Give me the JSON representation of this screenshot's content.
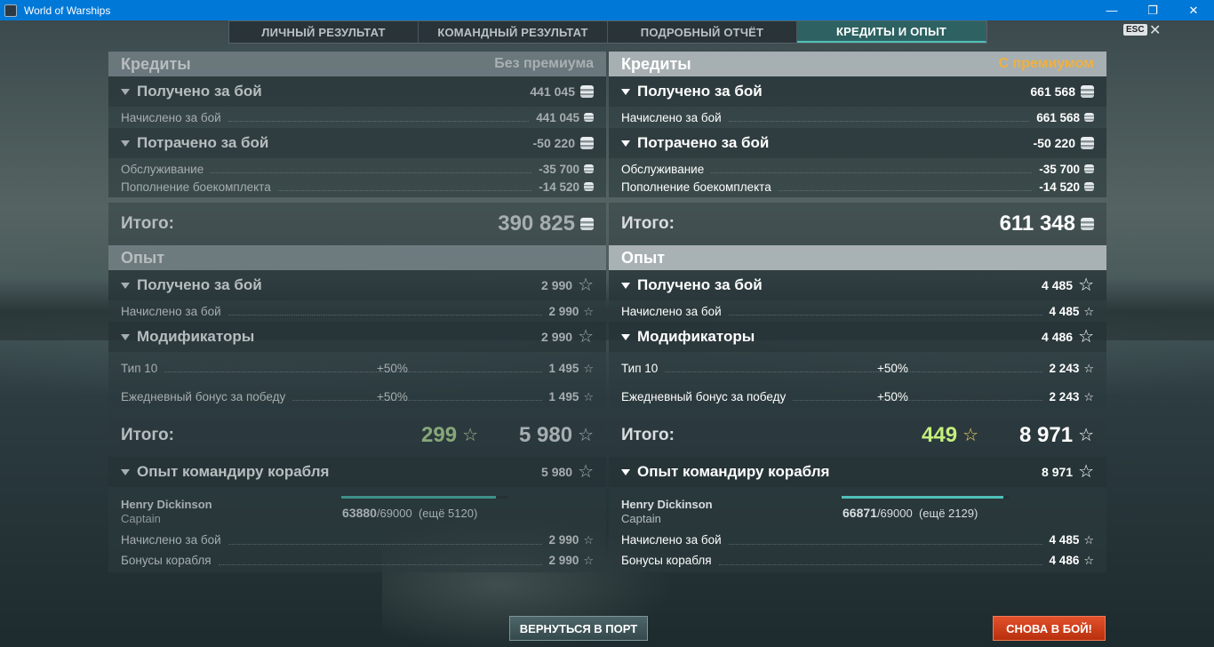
{
  "window": {
    "title": "World of Warships",
    "minimize": "—",
    "restore": "❐",
    "close": "✕"
  },
  "tabs": [
    {
      "label": "ЛИЧНЫЙ РЕЗУЛЬТАТ"
    },
    {
      "label": "КОМАНДНЫЙ РЕЗУЛЬТАТ"
    },
    {
      "label": "ПОДРОБНЫЙ ОТЧЁТ"
    },
    {
      "label": "КРЕДИТЫ И ОПЫТ"
    }
  ],
  "esc": {
    "key": "ESC",
    "close": "✕"
  },
  "left": {
    "credits": {
      "title": "Кредиты",
      "badge": "Без премиума",
      "earned": {
        "label": "Получено за бой",
        "value": "441 045"
      },
      "earned_rows": [
        {
          "label": "Начислено за бой",
          "value": "441 045"
        }
      ],
      "spent": {
        "label": "Потрачено за бой",
        "value": "-50 220"
      },
      "spent_rows": [
        {
          "label": "Обслуживание",
          "value": "-35 700"
        },
        {
          "label": "Пополнение боекомплекта",
          "value": "-14 520"
        }
      ],
      "total": {
        "label": "Итого:",
        "value": "390 825"
      }
    },
    "xp": {
      "title": "Опыт",
      "earned": {
        "label": "Получено за бой",
        "value": "2 990"
      },
      "earned_rows": [
        {
          "label": "Начислено за бой",
          "value": "2 990"
        }
      ],
      "mods": {
        "label": "Модификаторы",
        "value": "2 990"
      },
      "mod_rows": [
        {
          "label": "Тип 10",
          "pct": "+50%",
          "value": "1 495"
        },
        {
          "label": "Ежедневный бонус за победу",
          "pct": "+50%",
          "value": "1 495"
        }
      ],
      "total": {
        "label": "Итого:",
        "bonus": "299",
        "value": "5 980"
      },
      "commander": {
        "label": "Опыт командиру корабля",
        "value": "5 980"
      },
      "captain": {
        "name": "Henry Dickinson",
        "rank": "Captain",
        "current": "63880",
        "max": "/69000",
        "remaining": "(ещё 5120)",
        "progress": 0.926
      },
      "captain_rows": [
        {
          "label": "Начислено за бой",
          "value": "2 990"
        },
        {
          "label": "Бонусы корабля",
          "value": "2 990"
        }
      ]
    }
  },
  "right": {
    "credits": {
      "title": "Кредиты",
      "badge": "С премиумом",
      "earned": {
        "label": "Получено за бой",
        "value": "661 568"
      },
      "earned_rows": [
        {
          "label": "Начислено за бой",
          "value": "661 568"
        }
      ],
      "spent": {
        "label": "Потрачено за бой",
        "value": "-50 220"
      },
      "spent_rows": [
        {
          "label": "Обслуживание",
          "value": "-35 700"
        },
        {
          "label": "Пополнение боекомплекта",
          "value": "-14 520"
        }
      ],
      "total": {
        "label": "Итого:",
        "value": "611 348"
      }
    },
    "xp": {
      "title": "Опыт",
      "earned": {
        "label": "Получено за бой",
        "value": "4 485"
      },
      "earned_rows": [
        {
          "label": "Начислено за бой",
          "value": "4 485"
        }
      ],
      "mods": {
        "label": "Модификаторы",
        "value": "4 486"
      },
      "mod_rows": [
        {
          "label": "Тип 10",
          "pct": "+50%",
          "value": "2 243"
        },
        {
          "label": "Ежедневный бонус за победу",
          "pct": "+50%",
          "value": "2 243"
        }
      ],
      "total": {
        "label": "Итого:",
        "bonus": "449",
        "value": "8 971"
      },
      "commander": {
        "label": "Опыт командиру корабля",
        "value": "8 971"
      },
      "captain": {
        "name": "Henry Dickinson",
        "rank": "Captain",
        "current": "66871",
        "max": "/69000",
        "remaining": "(ещё 2129)",
        "progress": 0.969
      },
      "captain_rows": [
        {
          "label": "Начислено за бой",
          "value": "4 485"
        },
        {
          "label": "Бонусы корабля",
          "value": "4 486"
        }
      ]
    }
  },
  "buttons": {
    "port": "ВЕРНУТЬСЯ В ПОРТ",
    "battle": "СНОВА В БОЙ!"
  },
  "icons": {
    "credits": "credits-coin-icon",
    "xp": "star-icon",
    "collapse": "triangle-down-icon"
  },
  "colors": {
    "premium_badge": "#f0b040",
    "battle_button": "#d23e18",
    "bonus_xp": "#c4ef7e"
  }
}
